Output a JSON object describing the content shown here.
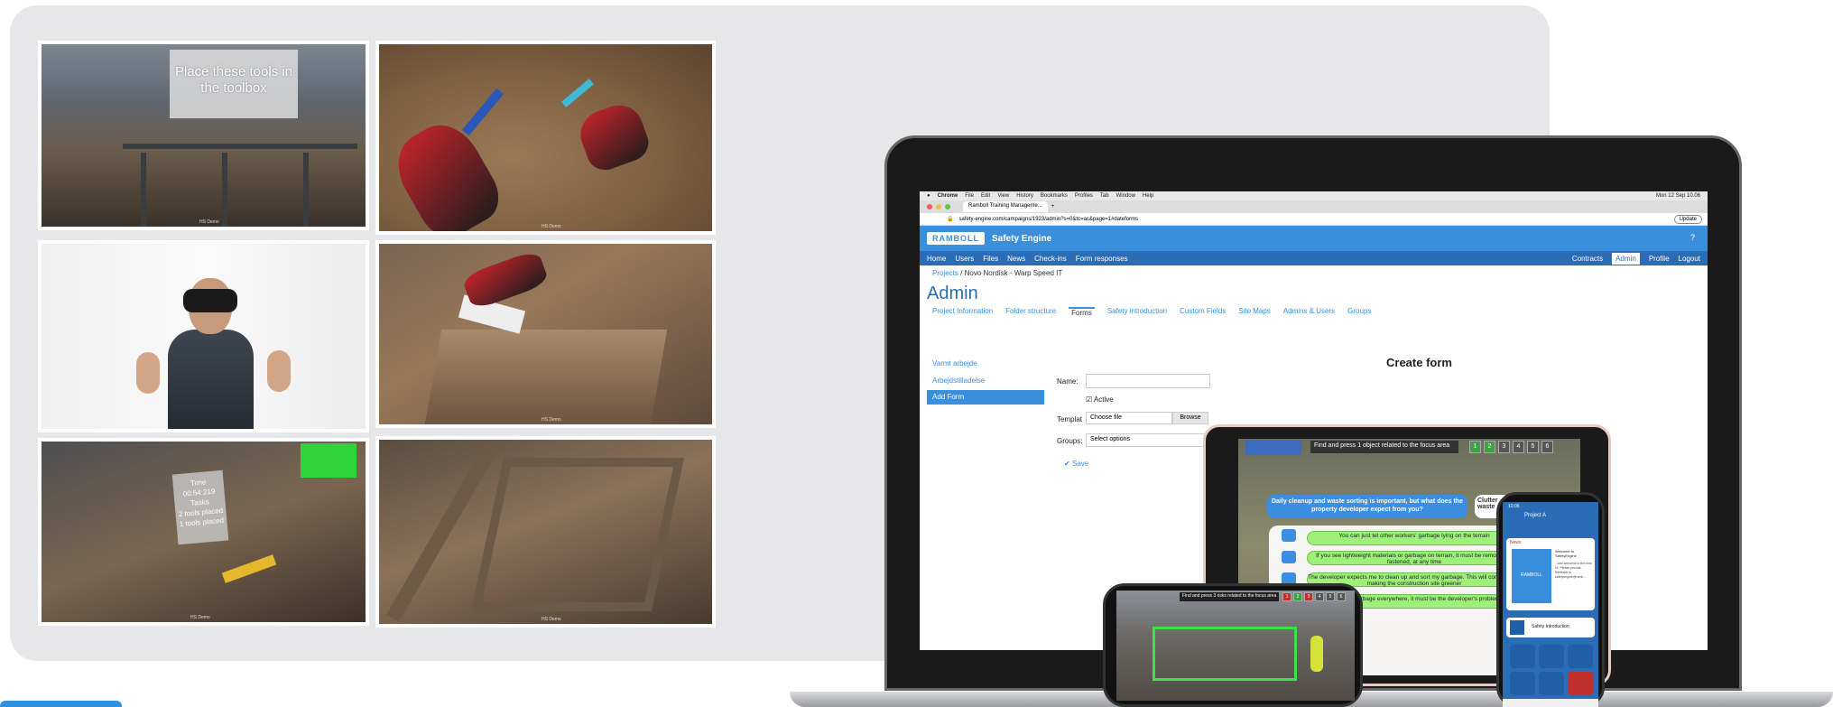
{
  "vr": {
    "caption": "Place these tools in the toolbox",
    "watermark": "HS Demo",
    "timer_title": "Time",
    "timer_value": "00:54:219",
    "timer_task": "Tasks",
    "timer_l1": "2 tools placed",
    "timer_l2": "1 tools placed"
  },
  "browser": {
    "menubar": [
      "Chrome",
      "File",
      "Edit",
      "View",
      "History",
      "Bookmarks",
      "Profiles",
      "Tab",
      "Window",
      "Help"
    ],
    "clock": "Mon 12 Sep 10.06",
    "tab_title": "Ramboll Training Manageme...",
    "url": "safety-engine.com/campaigns/1923/admin?s=0&tc=ac&page=1#dateforms",
    "update": "Update"
  },
  "app": {
    "logo": "RAMBOLL",
    "title": "Safety Engine",
    "help": "?",
    "nav": [
      "Home",
      "Users",
      "Files",
      "News",
      "Check-ins",
      "Form responses"
    ],
    "nav_right": [
      "Contracts",
      "Admin",
      "Profile",
      "Logout"
    ],
    "breadcrumb_projects": "Projects",
    "breadcrumb_sep": "/",
    "breadcrumb_current": "Novo Nordisk - Warp Speed IT",
    "page_title": "Admin",
    "subtabs": [
      "Project Information",
      "Folder structure",
      "Forms",
      "Safety introduction",
      "Custom Fields",
      "Site Maps",
      "Admins & Users",
      "Groups"
    ],
    "side": [
      "Varmt arbejde",
      "Arbejdstilladelse"
    ],
    "add_form": "Add Form",
    "create_title": "Create form",
    "name_label": "Name:",
    "active_label": "Active",
    "template_label": "Templat",
    "choose_file": "Choose file",
    "browse": "Browse",
    "groups_label": "Groups:",
    "select_placeholder": "Select options",
    "save": "Save"
  },
  "tablet": {
    "task_bar": "Find and press 1 object related to the focus area",
    "numbers": [
      "1",
      "2",
      "3",
      "4",
      "5",
      "6"
    ],
    "question": "Daily cleanup and waste sorting is important, but what does the property developer expect from you?",
    "question2": "Clutter waste",
    "answers": [
      "You can just let other workers' garbage lying on the terrain",
      "If you see lightweight materials or garbage on terrain, it must be removed or fastened, at any time",
      "The developer expects me to clean up and sort my garbage. This will contribute to making the construction site greener",
      "If there is garbage everywhere, it must be the developer's problem"
    ]
  },
  "phone1": {
    "task_bar": "Find and press 3 risks related to the focus area",
    "numbers": [
      "1",
      "2",
      "3",
      "4",
      "5",
      "6"
    ]
  },
  "phone2": {
    "time": "10:06",
    "project": "Project A",
    "news": "News",
    "welcome_title": "Welcome to SafetyEngine",
    "welcome_body": "...and welcome to the new UI. Please provide feedback to safetyengine@ramb...",
    "logo": "RAMBOLL",
    "safety_intro": "Safety Introduction",
    "icons": [
      "Check-in",
      "Check-in",
      "Forms",
      "Files",
      "Maps",
      "Emergency"
    ]
  }
}
